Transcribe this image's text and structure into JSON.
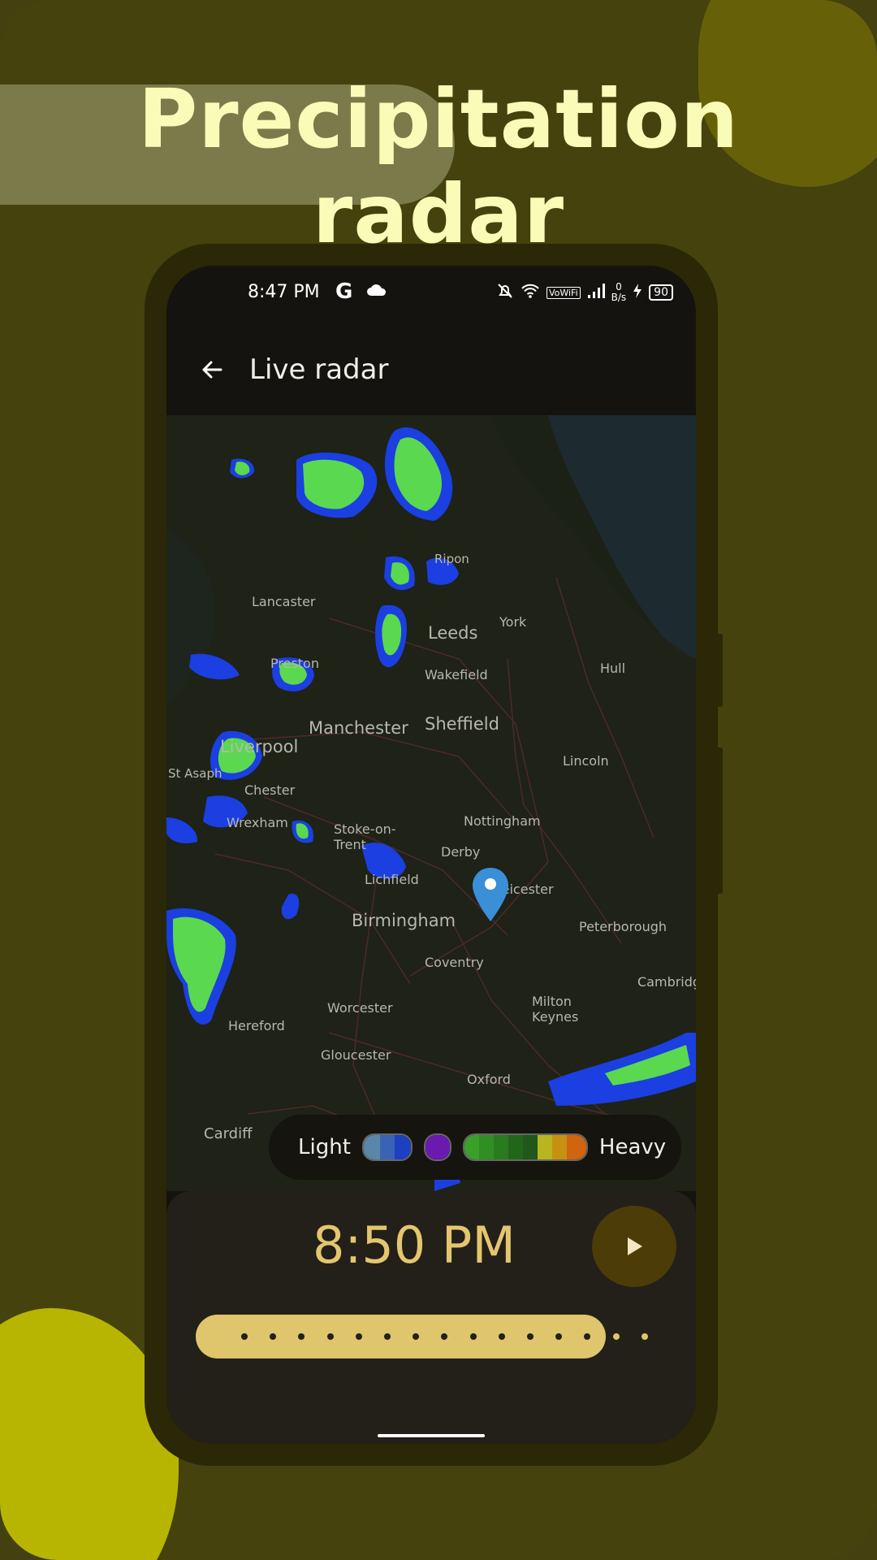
{
  "headline": "Precipitation radar",
  "status_bar": {
    "time": "8:47 PM",
    "google_glyph": "G",
    "network_speed_value": "0",
    "network_speed_unit": "B/s",
    "volte": "VoWiFi",
    "battery": "90"
  },
  "appbar": {
    "title": "Live radar"
  },
  "map": {
    "places": [
      "Ripon",
      "Lancaster",
      "York",
      "Leeds",
      "Hull",
      "Wakefield",
      "Preston",
      "Manchester",
      "Sheffield",
      "Liverpool",
      "Lincoln",
      "Chester",
      "Wrexham",
      "Nottingham",
      "Stoke-on-Trent",
      "Derby",
      "Lichfield",
      "Leicester",
      "Birmingham",
      "Peterborough",
      "Coventry",
      "Cambridge",
      "Hereford",
      "Worcester",
      "Milton Keynes",
      "Gloucester",
      "Oxford",
      "Cardiff",
      "St Asaph"
    ]
  },
  "legend": {
    "light": "Light",
    "heavy": "Heavy"
  },
  "playback": {
    "time": "8:50 PM",
    "progress_fraction": 0.85
  }
}
